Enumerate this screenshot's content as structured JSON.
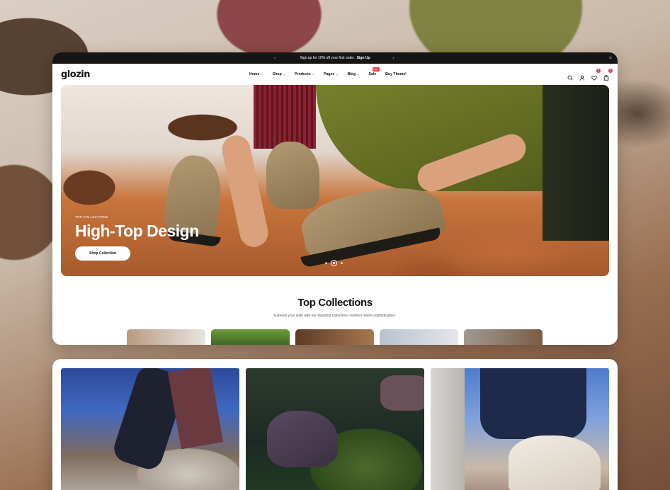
{
  "announcement": {
    "text": "Sign up for 10% off your first order.",
    "link": "Sign Up",
    "prev": "‹",
    "next": "›",
    "close": "×"
  },
  "header": {
    "logo": "glozin",
    "menu": [
      {
        "label": "Home",
        "chevron": "⌄"
      },
      {
        "label": "Shop",
        "chevron": "⌄"
      },
      {
        "label": "Products",
        "chevron": "⌄"
      },
      {
        "label": "Pages",
        "chevron": "⌄"
      },
      {
        "label": "Blog",
        "chevron": "⌄"
      },
      {
        "label": "Sale",
        "badge": "HOT"
      },
      {
        "label": "Buy Theme!"
      }
    ],
    "wishlist_count": "0",
    "cart_count": "0"
  },
  "hero": {
    "eyebrow": "TOP COLLECTIONS",
    "title": "High-Top Design",
    "button": "Shop Collection"
  },
  "collections": {
    "title": "Top Collections",
    "subtitle": "Express your style with our standout collection—fashion meets sophistication."
  },
  "colors": {
    "accent": "#e53935",
    "dark_bar": "#151515"
  }
}
